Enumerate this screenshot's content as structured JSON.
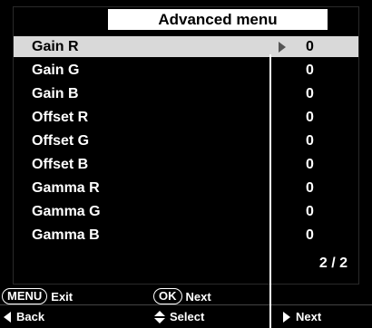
{
  "menu": {
    "title": "Advanced menu",
    "items": [
      {
        "label": "Gain R",
        "value": "0"
      },
      {
        "label": "Gain G",
        "value": "0"
      },
      {
        "label": "Gain B",
        "value": "0"
      },
      {
        "label": "Offset R",
        "value": "0"
      },
      {
        "label": "Offset G",
        "value": "0"
      },
      {
        "label": "Offset B",
        "value": "0"
      },
      {
        "label": "Gamma R",
        "value": "0"
      },
      {
        "label": "Gamma G",
        "value": "0"
      },
      {
        "label": "Gamma B",
        "value": "0"
      }
    ],
    "page": "2 / 2"
  },
  "footer": {
    "menu_key": "MENU",
    "menu_action": "Exit",
    "ok_key": "OK",
    "ok_action": "Next",
    "back_label": "Back",
    "select_label": "Select",
    "next_label": "Next"
  },
  "colors": {
    "background": "#000000",
    "selected_row": "#d9d9d9",
    "title_bg": "#ffffff"
  }
}
